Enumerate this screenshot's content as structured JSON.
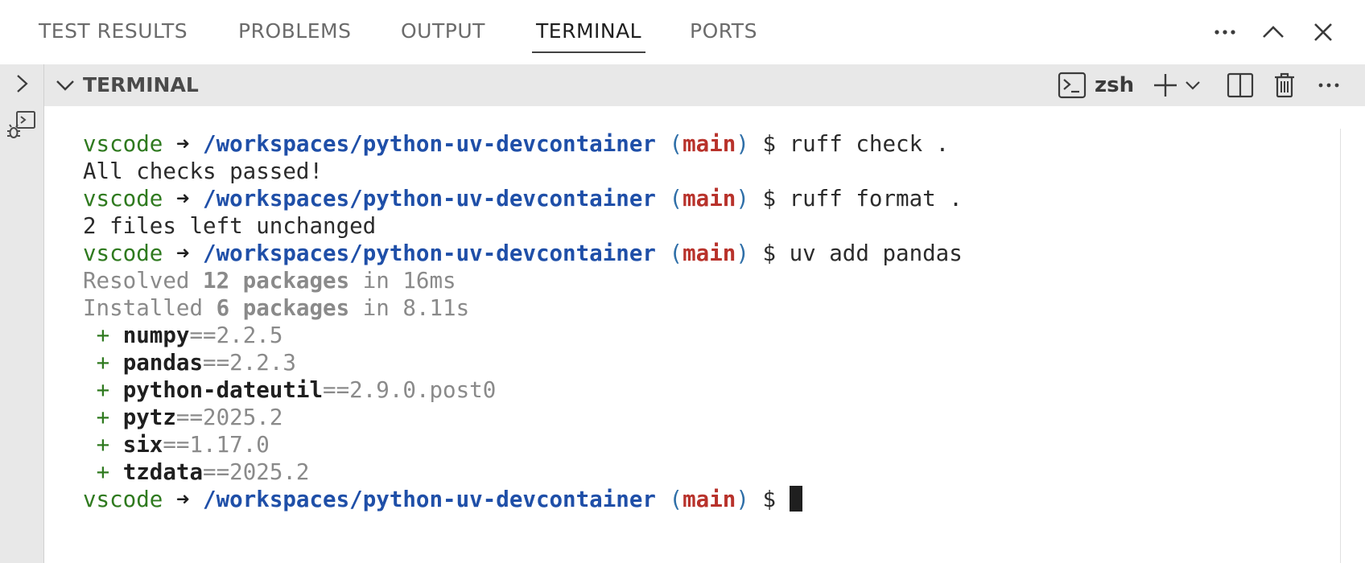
{
  "panel": {
    "tabs": [
      "TEST RESULTS",
      "PROBLEMS",
      "OUTPUT",
      "TERMINAL",
      "PORTS"
    ],
    "active_tab": "TERMINAL"
  },
  "terminal_header": {
    "title": "TERMINAL",
    "profile": "zsh"
  },
  "prompt": {
    "user": "vscode",
    "arrow": "➜",
    "path": "/workspaces/python-uv-devcontainer",
    "branch": "main",
    "symbol": "$"
  },
  "terminal_lines": [
    {
      "type": "cmd",
      "command": "ruff check ."
    },
    {
      "type": "out",
      "text": "All checks passed!"
    },
    {
      "type": "cmd",
      "command": "ruff format ."
    },
    {
      "type": "out",
      "text": "2 files left unchanged"
    },
    {
      "type": "cmd",
      "command": "uv add pandas"
    },
    {
      "type": "stat",
      "verb": "Resolved",
      "count": "12 packages",
      "time": "in 16ms"
    },
    {
      "type": "stat",
      "verb": "Installed",
      "count": "6 packages",
      "time": "in 8.11s"
    },
    {
      "type": "pkg",
      "sign": "+",
      "name": "numpy",
      "version": "==2.2.5"
    },
    {
      "type": "pkg",
      "sign": "+",
      "name": "pandas",
      "version": "==2.2.3"
    },
    {
      "type": "pkg",
      "sign": "+",
      "name": "python-dateutil",
      "version": "==2.9.0.post0"
    },
    {
      "type": "pkg",
      "sign": "+",
      "name": "pytz",
      "version": "==2025.2"
    },
    {
      "type": "pkg",
      "sign": "+",
      "name": "six",
      "version": "==1.17.0"
    },
    {
      "type": "pkg",
      "sign": "+",
      "name": "tzdata",
      "version": "==2025.2"
    },
    {
      "type": "cmd",
      "command": "",
      "cursor": true
    }
  ],
  "colors": {
    "user": "#2f7a1f",
    "path": "#1f4fa8",
    "paren": "#2f6fa8",
    "branch": "#b8322b",
    "dim": "#8a8a8a",
    "strip_bg": "#e8e8e8"
  },
  "icons": {
    "more": "more-icon",
    "maximize": "chevron-up-icon",
    "close": "close-icon",
    "expand": "chevron-right-icon",
    "debug": "debug-console-icon",
    "collapse": "chevron-down-icon",
    "terminal": "terminal-icon",
    "new": "plus-icon",
    "launch_profile": "chevron-down-icon",
    "split": "split-icon",
    "kill": "trash-icon",
    "header_more": "more-icon"
  }
}
